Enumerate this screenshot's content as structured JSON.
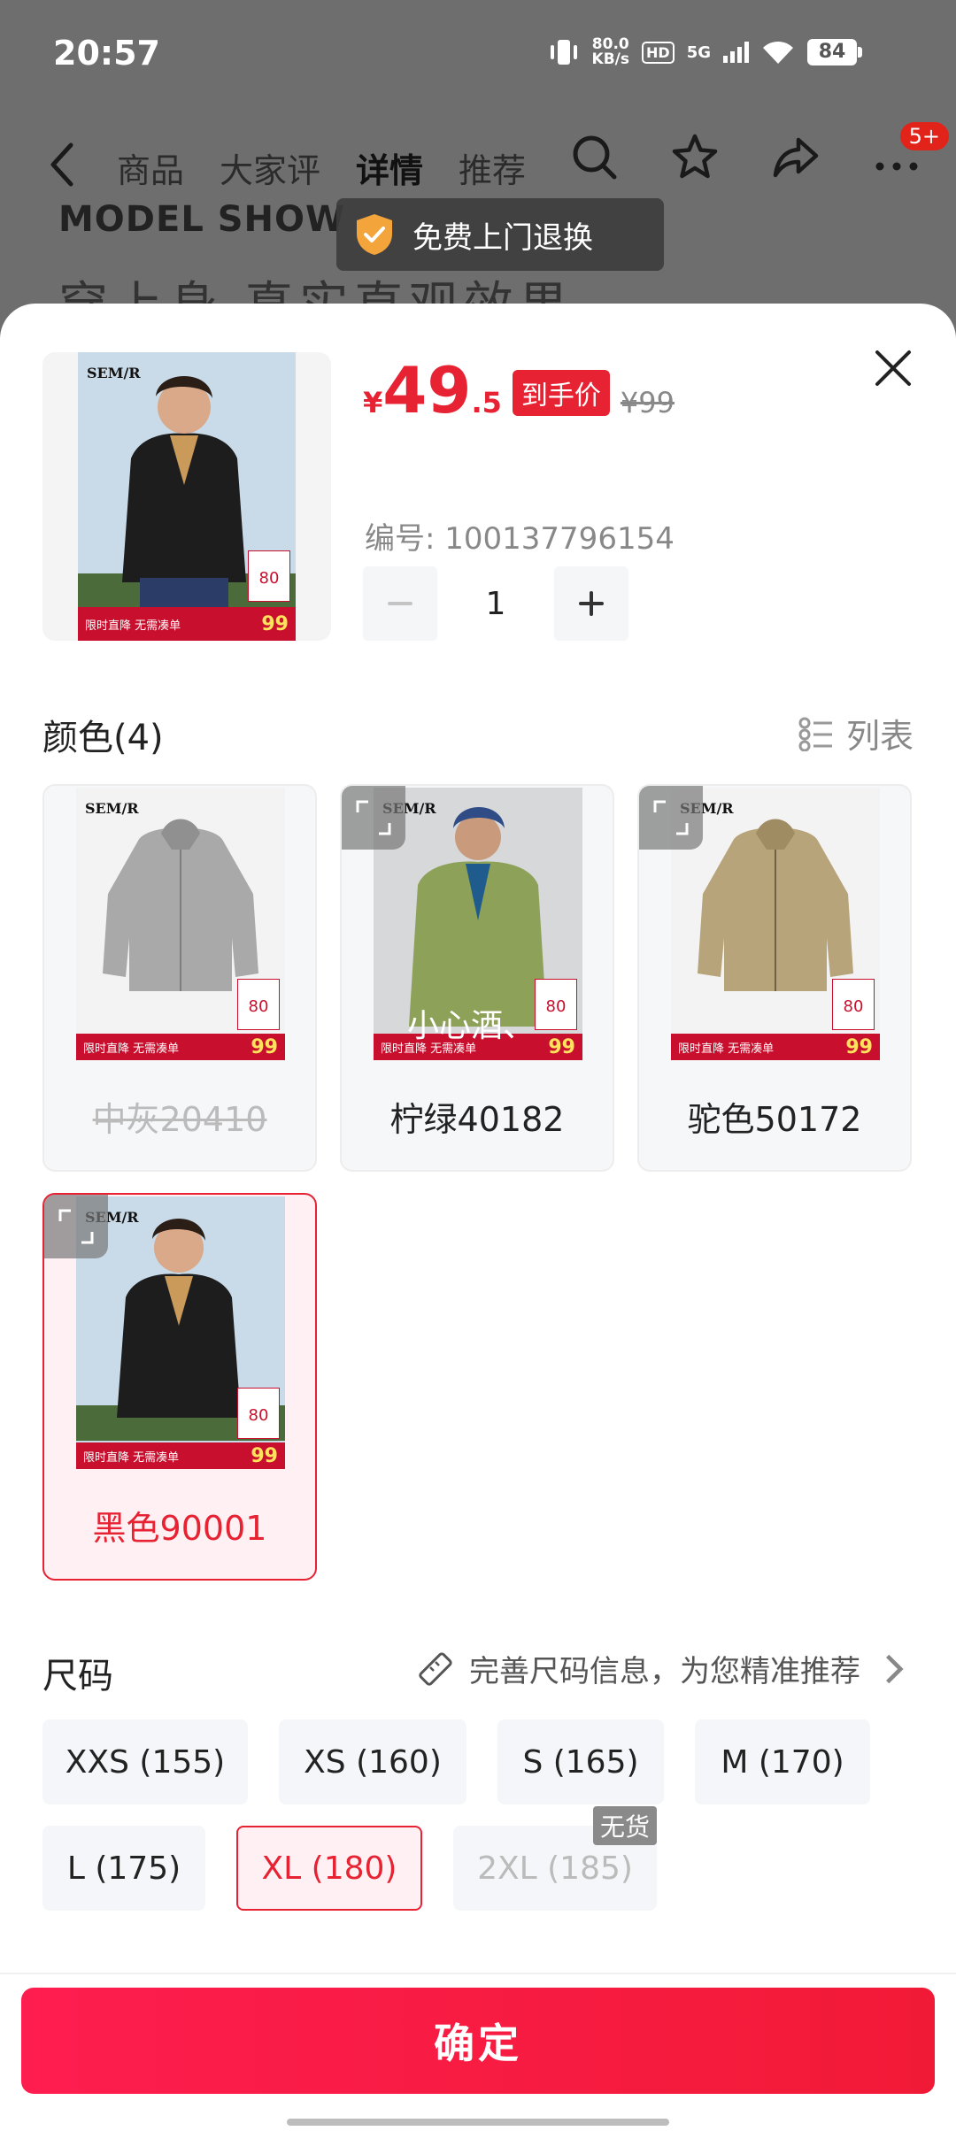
{
  "status_bar": {
    "time": "20:57",
    "net_speed_value": "80.0",
    "net_speed_unit": "KB/s",
    "hd": "HD",
    "network": "5G",
    "battery": "84"
  },
  "nav": {
    "tabs": [
      "商品",
      "大家评",
      "详情",
      "推荐"
    ],
    "active_tab": "详情",
    "cart_badge": "5+"
  },
  "background": {
    "section_title": "MODEL SHOW",
    "section_subtitle": "穿上身  真实直观效果",
    "toast": "免费上门退换"
  },
  "product": {
    "price_currency": "¥",
    "price_int": "49",
    "price_dec": ".5",
    "price_tag": "到手价",
    "original_price": "¥99",
    "sku_label": "编号: 100137796154",
    "quantity": "1",
    "brand": "SEM/R",
    "promo_text": "限时直降 无需凑单",
    "promo_price": "99",
    "coupon_value": "80"
  },
  "colors": {
    "title": "颜色(4)",
    "list_toggle": "列表",
    "items": [
      {
        "label": "中灰20410",
        "state": "disabled"
      },
      {
        "label": "柠绿40182",
        "state": "normal",
        "watermark": "小心酒、"
      },
      {
        "label": "驼色50172",
        "state": "normal"
      },
      {
        "label": "黑色90001",
        "state": "selected"
      }
    ]
  },
  "sizes": {
    "title": "尺码",
    "hint": "完善尺码信息，为您精准推荐",
    "items": [
      {
        "label": "XXS (155)",
        "state": "normal"
      },
      {
        "label": "XS (160)",
        "state": "normal"
      },
      {
        "label": "S (165)",
        "state": "normal"
      },
      {
        "label": "M (170)",
        "state": "normal"
      },
      {
        "label": "L (175)",
        "state": "normal"
      },
      {
        "label": "XL (180)",
        "state": "selected"
      },
      {
        "label": "2XL (185)",
        "state": "disabled",
        "badge": "无货"
      }
    ]
  },
  "confirm_label": "确定",
  "theme": {
    "accent": "#e62233",
    "confirm_gradient_start": "#fe1d4f",
    "confirm_gradient_end": "#f11a36"
  }
}
